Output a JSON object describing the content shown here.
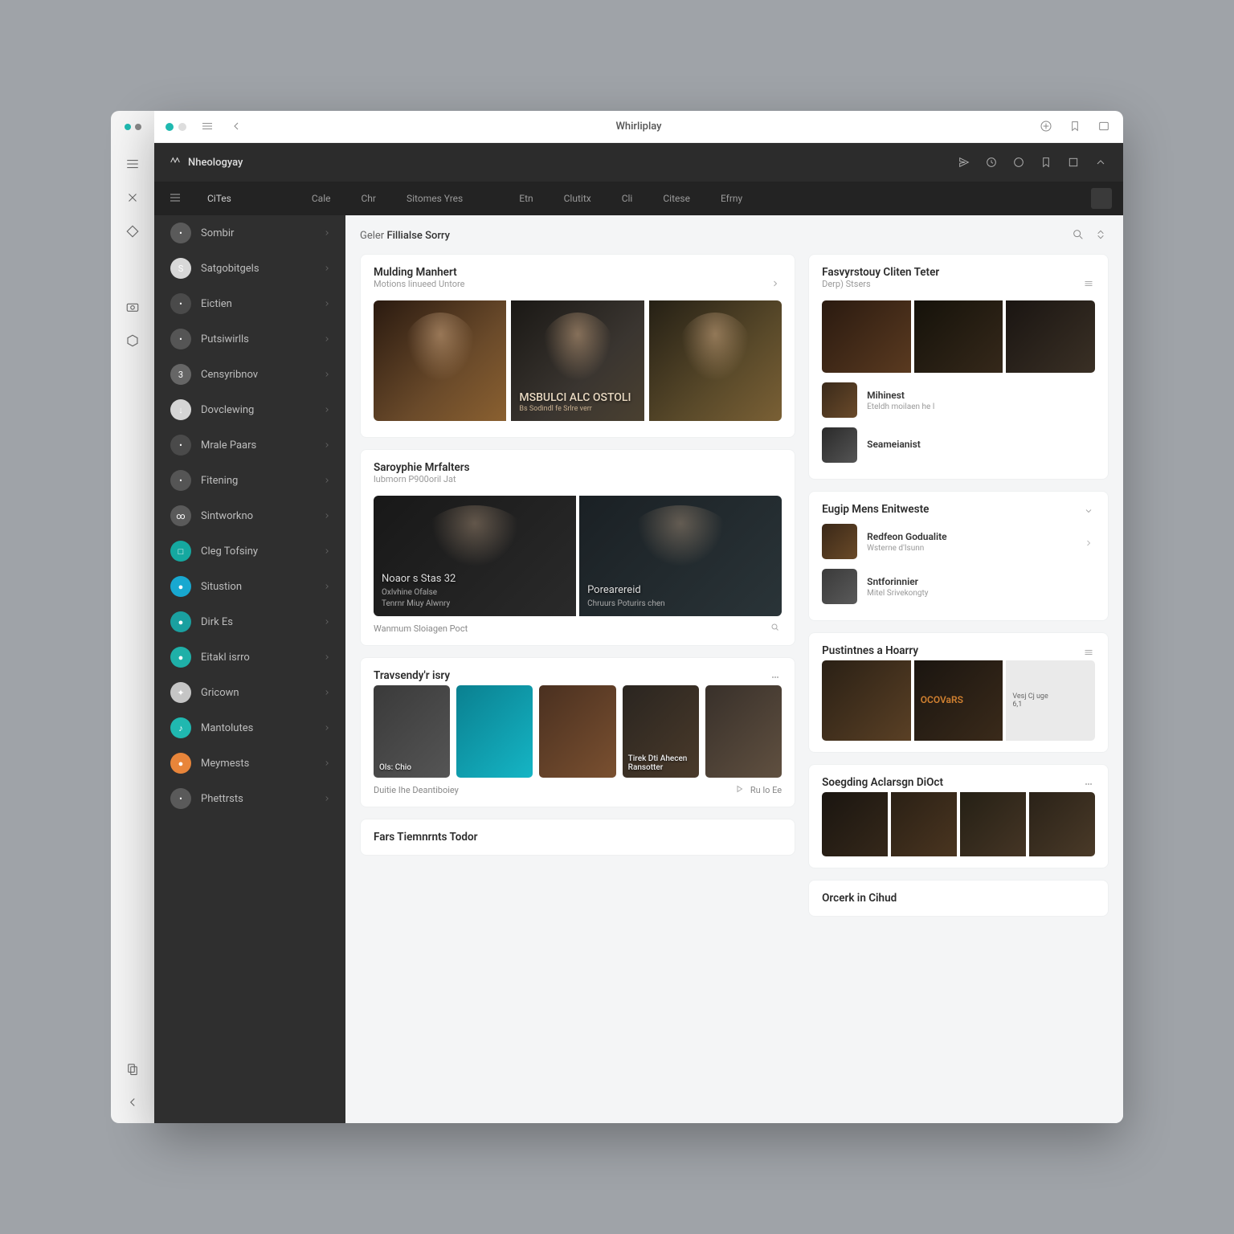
{
  "window_title": "Whirliplay",
  "app_name": "Nheologyay",
  "outer_icons": [
    "menu",
    "tools",
    "diamond",
    "camera",
    "hex",
    "copy",
    "back"
  ],
  "titlebar_icons": [
    "compass",
    "bookmark",
    "picture"
  ],
  "header_icons": [
    "send",
    "clock",
    "circle",
    "tag",
    "square",
    "up"
  ],
  "tabs": [
    "CiTes",
    "Cale",
    "Chr",
    "Sitomes Yres",
    "Etn",
    "Clutitx",
    "Cli",
    "Citese",
    "Efrny"
  ],
  "sidebar": [
    {
      "label": "Sombir",
      "color": "#5a5a5a",
      "letter": "•"
    },
    {
      "label": "Satgobitgels",
      "color": "#d8d8d8",
      "letter": "S"
    },
    {
      "label": "Eictien",
      "color": "#4a4a4a",
      "letter": "•"
    },
    {
      "label": "Putsiwirlls",
      "color": "#555",
      "letter": "•"
    },
    {
      "label": "Censyribnov",
      "color": "#666",
      "letter": "3"
    },
    {
      "label": "Dovclewing",
      "color": "#d5d5d5",
      "letter": "↓"
    },
    {
      "label": "Mrale Paars",
      "color": "#4a4a4a",
      "letter": "•"
    },
    {
      "label": "Fitening",
      "color": "#555",
      "letter": "•"
    },
    {
      "label": "Sintworkno",
      "color": "#5a5a5a",
      "letter": "∞"
    },
    {
      "label": "Cleg Tofsiny",
      "color": "#15a8a0",
      "letter": "□"
    },
    {
      "label": "Situstion",
      "color": "#18a8d0",
      "letter": "●"
    },
    {
      "label": "Dirk Es",
      "color": "#1aa0a0",
      "letter": "●"
    },
    {
      "label": "Eitakl isrro",
      "color": "#1fb0a8",
      "letter": "●"
    },
    {
      "label": "Gricown",
      "color": "#c5c5c5",
      "letter": "✦"
    },
    {
      "label": "Mantolutes",
      "color": "#20b8b0",
      "letter": "♪"
    },
    {
      "label": "Meymests",
      "color": "#e8853a",
      "letter": "●"
    },
    {
      "label": "Phettrsts",
      "color": "#5a5a5a",
      "letter": "•"
    }
  ],
  "breadcrumb": {
    "a": "Geler",
    "b": "Fillialse Sorry"
  },
  "cards": {
    "left": [
      {
        "title": "Mulding Manhert",
        "sub": "Motions linueed Untore",
        "hero_txt": "MSBULCI ALC OSTOLI",
        "hero_sub": "Bs Sodindl fe Srlre verr"
      },
      {
        "title": "Saroyphie Mrfalters",
        "sub": "lubmorn P900oril Jat",
        "p1_t": "Noaor s Stas 32",
        "p1_s": "Oxlvhine Ofalse",
        "p1_s2": "Tenrnr Miuy Alwnry",
        "p2_t": "Porearereid",
        "p2_s": "Chruurs Poturirs chen",
        "foot": "Wanmum Sloiagen Poct"
      },
      {
        "title": "Travsendy'r isry",
        "thumbs": [
          "Ols: Chio",
          "",
          "",
          "Tirek Dti Ahecen Ransotter",
          ""
        ],
        "foot": "Duitie Ihe Deantiboiey",
        "foot_icon": "Ru lo Ee"
      },
      {
        "title": "Fars Tiemnrnts Todor"
      }
    ],
    "right": [
      {
        "title": "Fasvyrstouy Cliten Teter",
        "sub": "Derp) Stsers"
      },
      {
        "title_a": "Mihinest",
        "sub_a": "Eteldh moilaen he l",
        "title_b": "Seameianist",
        "sub_b": ""
      },
      {
        "title": "Eugip Mens Enitweste",
        "a_t": "Redfeon Godualite",
        "a_s": "Wsterne d'Isunn",
        "b_t": "Sntforinnier",
        "b_s": "Mitel Srivekongty"
      },
      {
        "title": "Pustintnes a Hoarry",
        "p2_big": "OCOVaRS",
        "p3_a": "Vesj Cj uge",
        "p3_b": "6,1"
      },
      {
        "title": "Soegding Aclarsgn DiOct"
      },
      {
        "title": "Orcerk in Cihud"
      }
    ]
  },
  "colors": {
    "teal": "#1fb9b0",
    "orange": "#e8853a",
    "dark": "#2c2c2c"
  }
}
